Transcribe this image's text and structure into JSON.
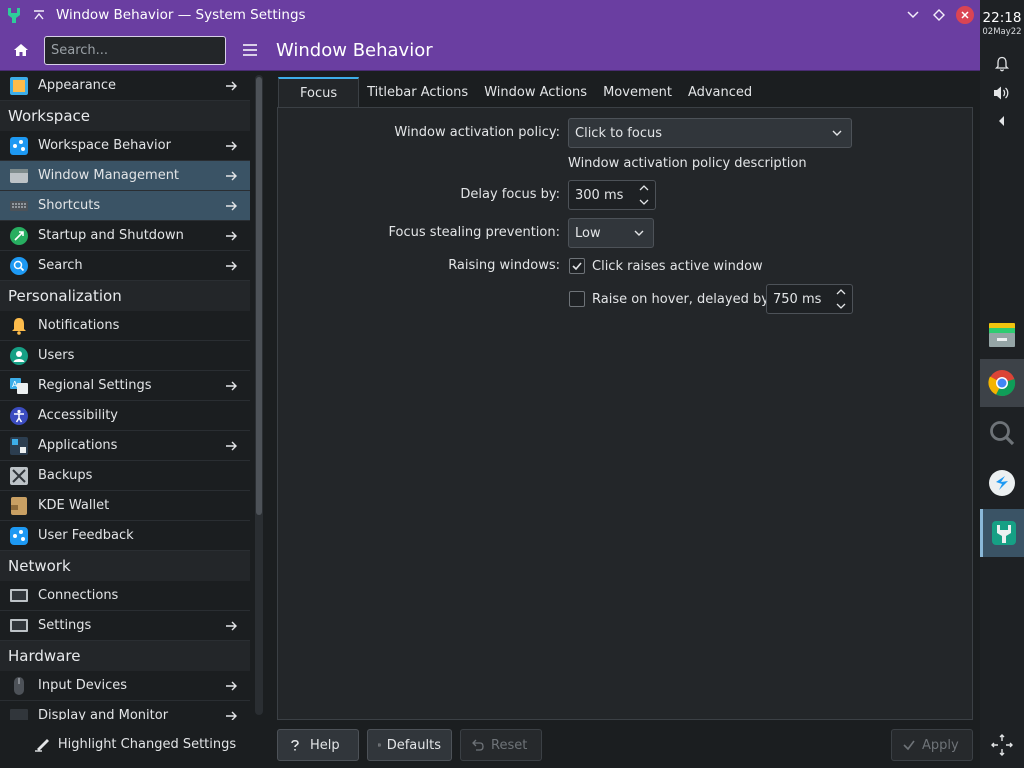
{
  "window": {
    "title": "Window Behavior — System Settings"
  },
  "header": {
    "search_placeholder": "Search...",
    "page_title": "Window Behavior"
  },
  "sidebar": {
    "top_items": [
      {
        "label": "Appearance"
      }
    ],
    "categories": [
      {
        "title": "Workspace",
        "items": [
          {
            "label": "Workspace Behavior"
          },
          {
            "label": "Window Management"
          },
          {
            "label": "Shortcuts"
          },
          {
            "label": "Startup and Shutdown"
          },
          {
            "label": "Search"
          }
        ]
      },
      {
        "title": "Personalization",
        "items": [
          {
            "label": "Notifications"
          },
          {
            "label": "Users"
          },
          {
            "label": "Regional Settings"
          },
          {
            "label": "Accessibility"
          },
          {
            "label": "Applications"
          },
          {
            "label": "Backups"
          },
          {
            "label": "KDE Wallet"
          },
          {
            "label": "User Feedback"
          }
        ]
      },
      {
        "title": "Network",
        "items": [
          {
            "label": "Connections"
          },
          {
            "label": "Settings"
          }
        ]
      },
      {
        "title": "Hardware",
        "items": [
          {
            "label": "Input Devices"
          },
          {
            "label": "Display and Monitor"
          }
        ]
      }
    ],
    "highlight_button": "Highlight Changed Settings"
  },
  "tabs": [
    {
      "label": "Focus",
      "active": true
    },
    {
      "label": "Titlebar Actions"
    },
    {
      "label": "Window Actions"
    },
    {
      "label": "Movement"
    },
    {
      "label": "Advanced"
    }
  ],
  "focus": {
    "activation_policy_label": "Window activation policy:",
    "activation_policy_value": "Click to focus",
    "activation_policy_description": "Window activation policy description",
    "delay_focus_label": "Delay focus by:",
    "delay_focus_value": "300 ms",
    "focus_stealing_label": "Focus stealing prevention:",
    "focus_stealing_value": "Low",
    "raising_label": "Raising windows:",
    "click_raises_label": "Click raises active window",
    "click_raises_checked": true,
    "raise_hover_label": "Raise on hover, delayed by:",
    "raise_hover_checked": false,
    "raise_hover_value": "750 ms"
  },
  "footer": {
    "help": "Help",
    "defaults": "Defaults",
    "reset": "Reset",
    "apply": "Apply"
  },
  "panel": {
    "time": "22:18",
    "date": "02May22"
  },
  "colors": {
    "titlebar": "#6a3ea1",
    "selection": "#3a5365",
    "accent": "#3daee9"
  }
}
